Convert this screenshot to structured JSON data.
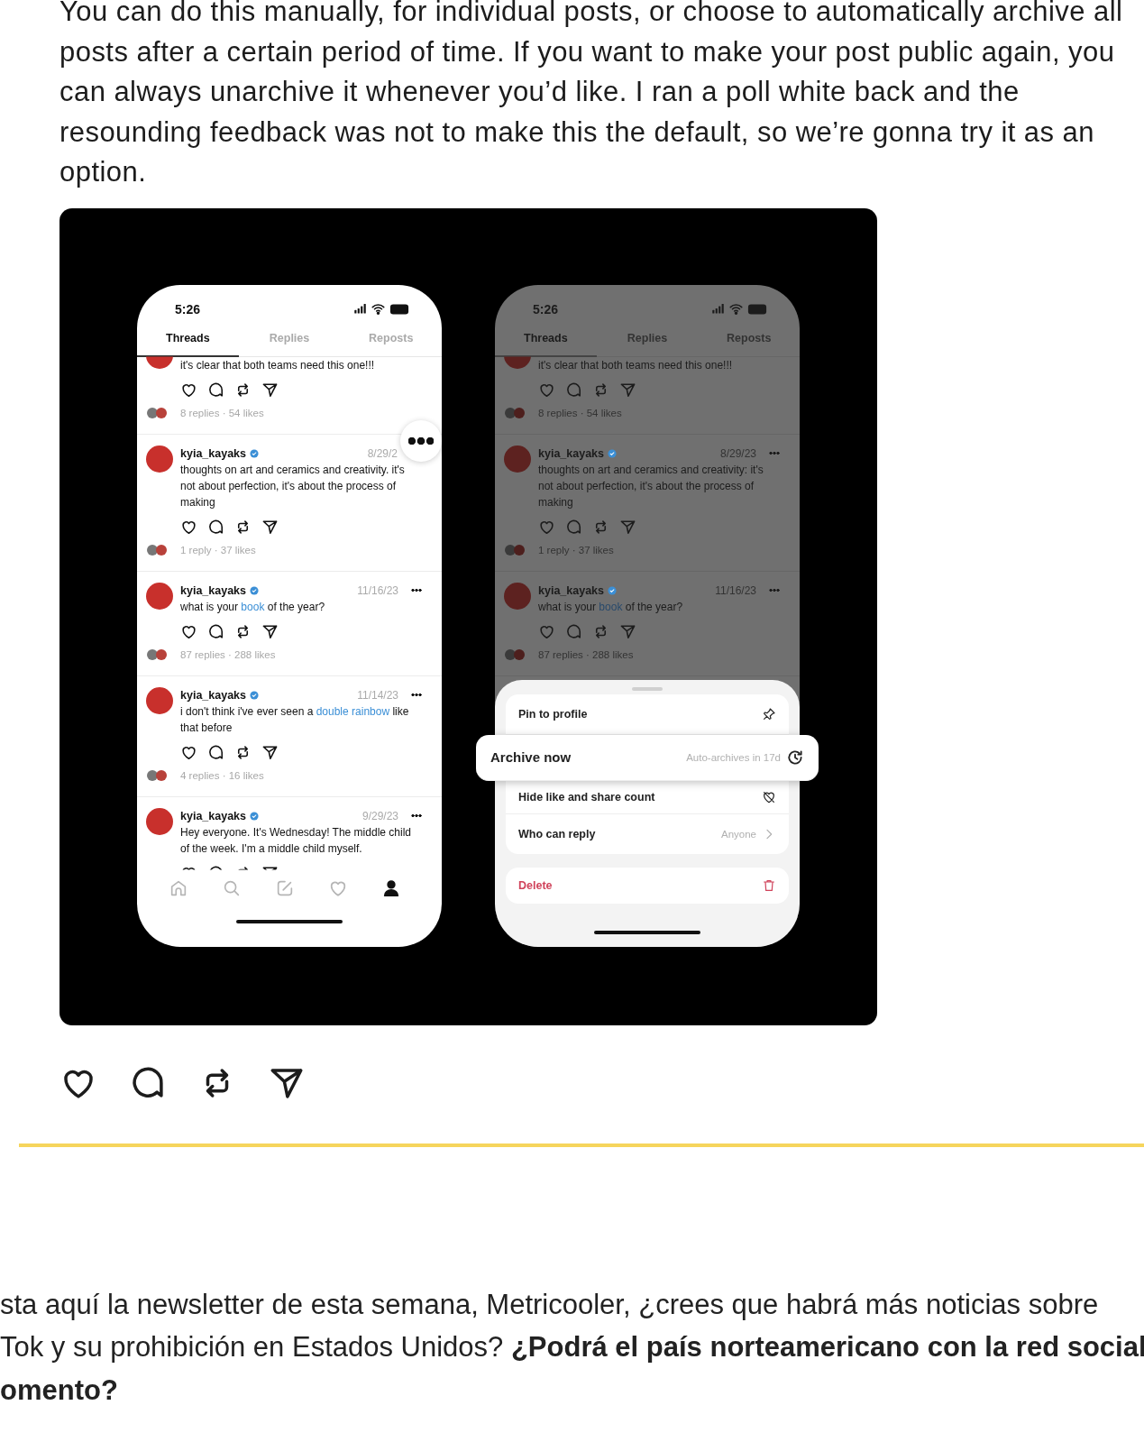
{
  "intro": {
    "lines": [
      "You can do this manually, for individual posts, or choose to automatically archive all",
      "posts after a certain period of time. If you want to make your post public again, you",
      "can always unarchive it whenever you’d like. I ran a poll white back and the",
      "resounding feedback was not to make this the default, so we’re gonna try it as an",
      "option."
    ]
  },
  "image": {
    "phones": [
      {
        "dimmed": false,
        "time": "5:26",
        "tabs": [
          {
            "label": "Threads",
            "selected": true
          },
          {
            "label": "Replies",
            "selected": false
          },
          {
            "label": "Reposts",
            "selected": false
          }
        ],
        "posts": [
          {
            "partial": true,
            "body": [
              {
                "text": "it's clear that both teams need this one!!!",
                "link": false
              }
            ],
            "stats": "8 replies · 54 likes"
          },
          {
            "partial": false,
            "username": "kyia_kayaks",
            "verified": true,
            "date": "8/29/2",
            "more_highlighted": true,
            "body": [
              {
                "text": "thoughts on art and ceramics and creativity. it's not about perfection, it's about the process of making",
                "link": false
              }
            ],
            "stats": "1 reply · 37 likes"
          },
          {
            "partial": false,
            "username": "kyia_kayaks",
            "verified": true,
            "date": "11/16/23",
            "more_highlighted": false,
            "body": [
              {
                "text": "what is your ",
                "link": false
              },
              {
                "text": "book",
                "link": true
              },
              {
                "text": " of the year?",
                "link": false
              }
            ],
            "stats": "87 replies · 288 likes"
          },
          {
            "partial": false,
            "username": "kyia_kayaks",
            "verified": true,
            "date": "11/14/23",
            "more_highlighted": false,
            "body": [
              {
                "text": "i don't think i've ever seen a ",
                "link": false
              },
              {
                "text": "double rainbow",
                "link": true
              },
              {
                "text": " like that before",
                "link": false
              }
            ],
            "stats": "4 replies · 16 likes"
          },
          {
            "partial": false,
            "username": "kyia_kayaks",
            "verified": true,
            "date": "9/29/23",
            "more_highlighted": false,
            "body": [
              {
                "text": "Hey everyone. It's Wednesday! The middle child of the week. I'm a middle child myself.",
                "link": false
              }
            ]
          }
        ],
        "nav": [
          {
            "kind": "home",
            "selected": false
          },
          {
            "kind": "search",
            "selected": false
          },
          {
            "kind": "compose",
            "selected": false
          },
          {
            "kind": "activity",
            "selected": false
          },
          {
            "kind": "profile",
            "selected": true
          }
        ]
      },
      {
        "dimmed": true,
        "time": "5:26",
        "tabs": [
          {
            "label": "Threads",
            "selected": true
          },
          {
            "label": "Replies",
            "selected": false
          },
          {
            "label": "Reposts",
            "selected": false
          }
        ],
        "posts": [
          {
            "partial": true,
            "body": [
              {
                "text": "it's clear that both teams need this one!!!",
                "link": false
              }
            ],
            "stats": "8 replies · 54 likes"
          },
          {
            "partial": false,
            "username": "kyia_kayaks",
            "verified": true,
            "date": "8/29/23",
            "more_highlighted": false,
            "body": [
              {
                "text": "thoughts on art and ceramics and creativity: it's not about perfection, it's about the process of making",
                "link": false
              }
            ],
            "stats": "1 reply · 37 likes"
          },
          {
            "partial": false,
            "username": "kyia_kayaks",
            "verified": true,
            "date": "11/16/23",
            "more_highlighted": false,
            "body": [
              {
                "text": "what is your ",
                "link": false
              },
              {
                "text": "book",
                "link": true
              },
              {
                "text": " of the year?",
                "link": false
              }
            ],
            "stats": "87 replies · 288 likes"
          }
        ],
        "sheet": {
          "groups": [
            {
              "items": [
                {
                  "kind": "pin",
                  "label": "Pin to profile",
                  "highlighted": false
                },
                {
                  "kind": "archive",
                  "label": "Archive now",
                  "detail": "Auto-archives in 17d",
                  "highlighted": true
                },
                {
                  "kind": "hide",
                  "label": "Hide like and share count",
                  "highlighted": false
                },
                {
                  "kind": "reply",
                  "label": "Who can reply",
                  "detail": "Anyone",
                  "highlighted": false
                }
              ]
            },
            {
              "items": [
                {
                  "kind": "delete",
                  "label": "Delete",
                  "highlighted": false
                }
              ]
            }
          ]
        }
      }
    ]
  },
  "actions": [
    {
      "kind": "like"
    },
    {
      "kind": "comment"
    },
    {
      "kind": "repost"
    },
    {
      "kind": "share"
    }
  ],
  "outro": {
    "lines": [
      "sta aquí la newsletter de esta semana, Metricooler, ¿crees que habrá más noticias sobre",
      "Tok y su prohibición en Estados Unidos? **¿Podrá el país norteamericano con la red social**",
      "**omento?**"
    ]
  }
}
